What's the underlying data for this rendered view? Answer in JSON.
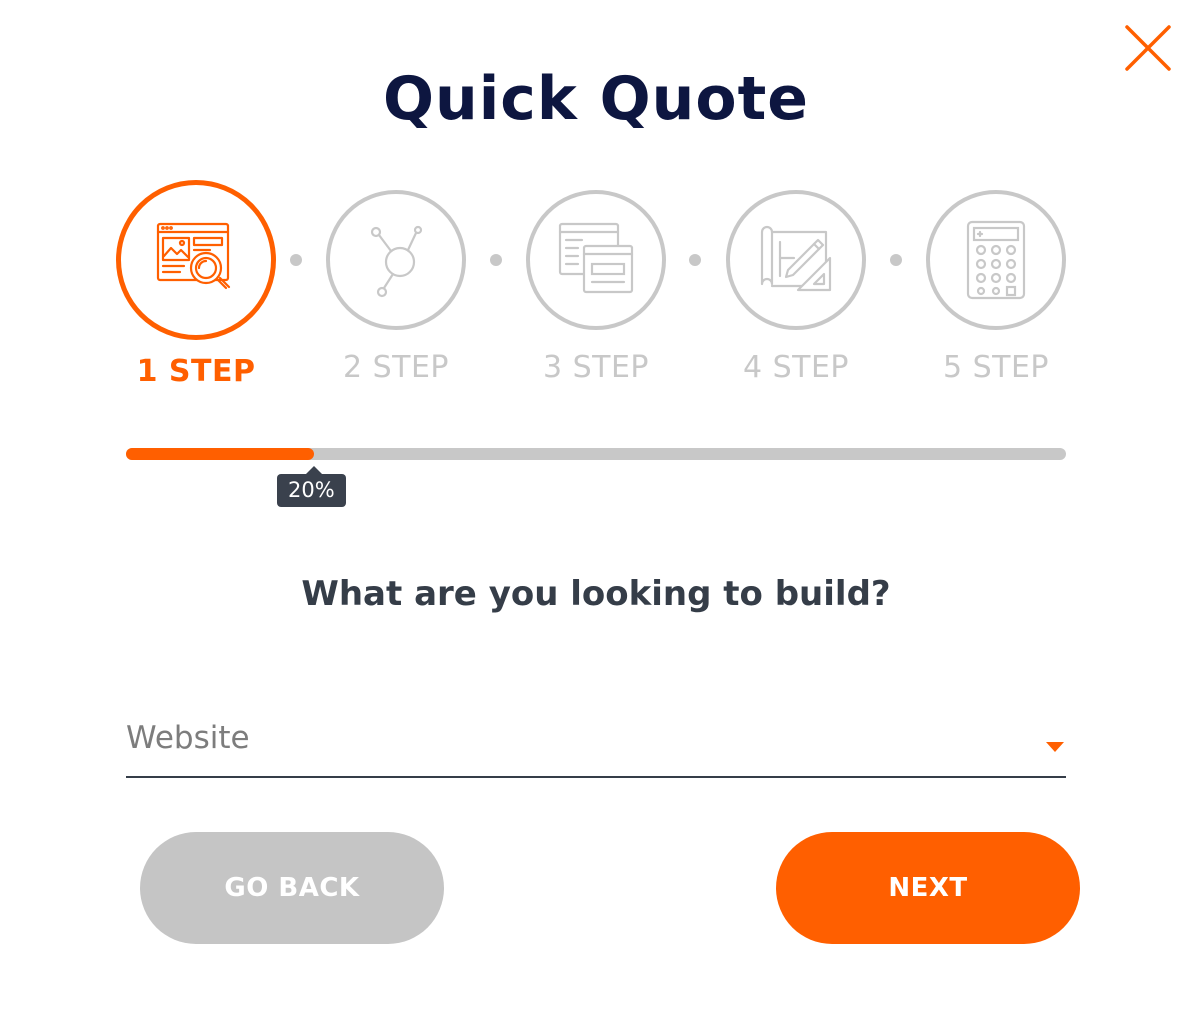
{
  "modal": {
    "title": "Quick Quote",
    "close_icon": "close-icon"
  },
  "colors": {
    "accent": "#ff5f00",
    "inactive": "#c8c8c8",
    "title": "#0d1640",
    "text_dark": "#353d48",
    "tooltip_bg": "#3a414d"
  },
  "steps": [
    {
      "label": "1 STEP",
      "icon": "website-search-icon",
      "active": true
    },
    {
      "label": "2 STEP",
      "icon": "network-nodes-icon",
      "active": false
    },
    {
      "label": "3 STEP",
      "icon": "browser-windows-icon",
      "active": false
    },
    {
      "label": "4 STEP",
      "icon": "blueprint-design-icon",
      "active": false
    },
    {
      "label": "5 STEP",
      "icon": "calculator-icon",
      "active": false
    }
  ],
  "progress": {
    "percent": 20,
    "label": "20%"
  },
  "question": "What are you looking to build?",
  "build_select": {
    "selected": "Website"
  },
  "buttons": {
    "back_label": "GO BACK",
    "next_label": "NEXT"
  }
}
